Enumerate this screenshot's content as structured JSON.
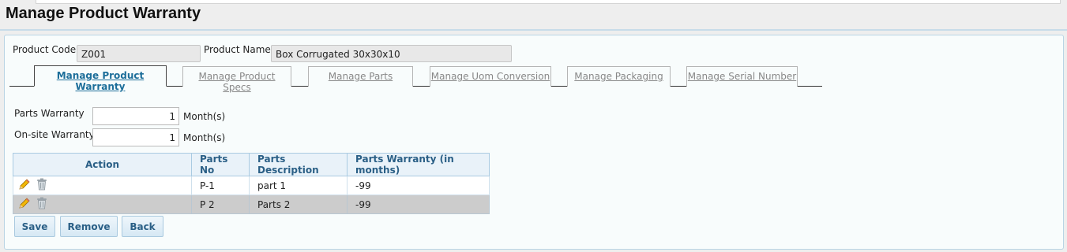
{
  "page": {
    "title": "Manage Product Warranty"
  },
  "product": {
    "code_label": "Product Code",
    "code_value": "Z001",
    "name_label": "Product Name",
    "name_value": "Box Corrugated 30x30x10"
  },
  "tabs": [
    {
      "label": "Manage Product Warranty",
      "active": true
    },
    {
      "label": "Manage Product Specs",
      "active": false
    },
    {
      "label": "Manage Parts",
      "active": false
    },
    {
      "label": "Manage Uom Conversion",
      "active": false
    },
    {
      "label": "Manage Packaging",
      "active": false
    },
    {
      "label": "Manage Serial Number",
      "active": false
    }
  ],
  "warranty": {
    "parts_label": "Parts Warranty",
    "parts_value": "1",
    "parts_unit": "Month(s)",
    "onsite_label": "On-site Warranty",
    "onsite_value": "1",
    "onsite_unit": "Month(s)"
  },
  "table": {
    "headers": [
      "Action",
      "Parts No",
      "Parts Description",
      "Parts Warranty (in months)"
    ],
    "rows": [
      {
        "parts_no": "P-1",
        "description": "part 1",
        "warranty": "-99"
      },
      {
        "parts_no": "P 2",
        "description": "Parts 2",
        "warranty": "-99"
      }
    ],
    "row_icons": [
      "pencil-edit-icon",
      "trash-can-icon"
    ]
  },
  "buttons": {
    "save": "Save",
    "remove": "Remove",
    "back": "Back"
  }
}
